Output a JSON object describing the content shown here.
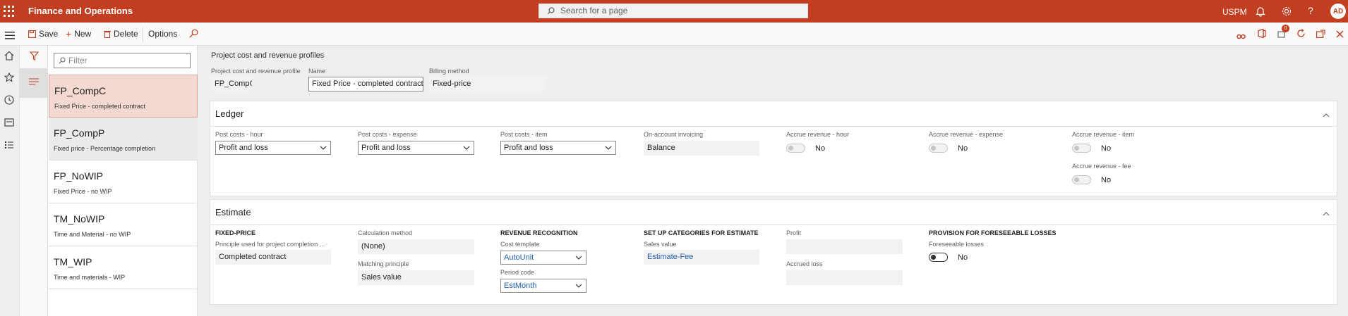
{
  "app": {
    "title": "Finance and Operations",
    "company": "USPM",
    "avatar": "AD"
  },
  "search": {
    "placeholder": "Search for a page"
  },
  "icons": {
    "waffle": "waffle-icon",
    "bell": "bell-icon",
    "settings": "gear-icon",
    "help": "help-icon"
  },
  "notification_count": "0",
  "actionbar": {
    "save": "Save",
    "new": "New",
    "delete": "Delete",
    "options": "Options"
  },
  "filter": {
    "placeholder": "Filter"
  },
  "records": [
    {
      "id": "FP_CompC",
      "desc": "Fixed Price - completed contract",
      "selected": true
    },
    {
      "id": "FP_CompP",
      "desc": "Fixed price - Percentage completion",
      "selected": false
    },
    {
      "id": "FP_NoWIP",
      "desc": "Fixed Price - no WIP",
      "selected": false
    },
    {
      "id": "TM_NoWIP",
      "desc": "Time and Material - no WIP",
      "selected": false
    },
    {
      "id": "TM_WIP",
      "desc": "Time and materials - WIP",
      "selected": false
    }
  ],
  "header": {
    "caption": "Project cost and revenue profiles",
    "profile_label": "Project cost and revenue profile",
    "profile_value": "FP_CompC",
    "name_label": "Name",
    "name_value": "Fixed Price - completed contract",
    "billing_label": "Billing method",
    "billing_value": "Fixed-price"
  },
  "ledger": {
    "title": "Ledger",
    "post_hour_label": "Post costs - hour",
    "post_hour_value": "Profit and loss",
    "post_expense_label": "Post costs - expense",
    "post_expense_value": "Profit and loss",
    "post_item_label": "Post costs - item",
    "post_item_value": "Profit and loss",
    "onaccount_label": "On-account invoicing",
    "onaccount_value": "Balance",
    "accrue_hour_label": "Accrue revenue - hour",
    "accrue_hour_value": "No",
    "accrue_expense_label": "Accrue revenue - expense",
    "accrue_expense_value": "No",
    "accrue_item_label": "Accrue revenue - item",
    "accrue_item_value": "No",
    "accrue_fee_label": "Accrue revenue - fee",
    "accrue_fee_value": "No"
  },
  "estimate": {
    "title": "Estimate",
    "fixed_price_group": "FIXED-PRICE",
    "principle_label": "Principle used for project completion ...",
    "principle_value": "Completed contract",
    "calc_label": "Calculation method",
    "calc_value": "(None)",
    "matching_label": "Matching principle",
    "matching_value": "Sales value",
    "revrec_group": "REVENUE RECOGNITION",
    "cost_template_label": "Cost template",
    "cost_template_value": "AutoUnit",
    "period_code_label": "Period code",
    "period_code_value": "EstMonth",
    "categories_group": "SET UP CATEGORIES FOR ESTIMATE",
    "sales_value_label": "Sales value",
    "sales_value_value": "Estimate-Fee",
    "profit_label": "Profit",
    "profit_value": "",
    "accrued_loss_label": "Accrued loss",
    "accrued_loss_value": "",
    "provision_group": "PROVISION FOR FORESEEABLE LOSSES",
    "foreseeable_label": "Foreseeable losses",
    "foreseeable_value": "No"
  }
}
